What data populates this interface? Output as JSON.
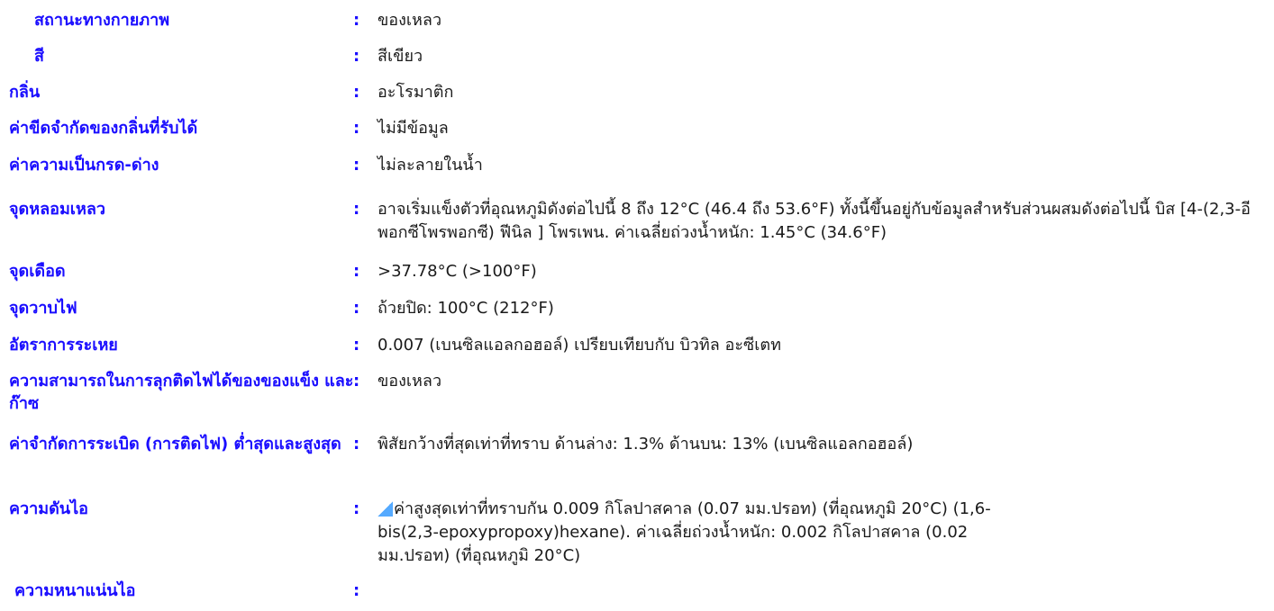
{
  "properties": [
    {
      "label": "สถานะทางกายภาพ",
      "colon": ":",
      "value": "ของเหลว"
    },
    {
      "label": "สี",
      "colon": ":",
      "value": "สีเขียว"
    },
    {
      "label": "กลิ่น",
      "colon": ":",
      "value": "อะโรมาติก"
    },
    {
      "label": "ค่าขีดจำกัดของกลิ่นที่รับได้",
      "colon": ":",
      "value": "ไม่มีข้อมูล"
    },
    {
      "label": "ค่าความเป็นกรด-ด่าง",
      "colon": ":",
      "value": "ไม่ละลายในน้ำ"
    },
    {
      "label": "จุดหลอมเหลว",
      "colon": ":",
      "value": "อาจเริ่มแข็งตัวที่อุณหภูมิดังต่อไปนี้ 8 ถึง 12°C (46.4 ถึง 53.6°F) ทั้งนี้ขึ้นอยู่กับข้อมูลสำหรับส่วนผสมดังต่อไปนี้ บิส [4-(2,3-อีพอกซีโพรพอกซี) ฟีนิล ] โพรเพน. ค่าเฉลี่ยถ่วงน้ำหนัก: 1.45°C (34.6°F)"
    },
    {
      "label": "จุดเดือด",
      "colon": ":",
      "value": ">37.78°C (>100°F)"
    },
    {
      "label": "จุดวาบไฟ",
      "colon": ":",
      "value": "ถ้วยปิด: 100°C (212°F)"
    },
    {
      "label": "อัตราการระเหย",
      "colon": ":",
      "value": "0.007 (เบนซิลแอลกอฮอล์) เปรียบเทียบกับ บิวทิล อะซีเตท"
    },
    {
      "label": "ความสามารถในการลุกติดไฟได้ของของแข็ง และก๊าซ",
      "colon": ":",
      "value": "ของเหลว"
    },
    {
      "label": "ค่าจำกัดการระเบิด (การติดไฟ) ต่ำสุดและสูงสุด",
      "colon": ":",
      "value": "พิสัยกว้างที่สุดเท่าที่ทราบ ด้านล่าง: 1.3%  ด้านบน: 13% (เบนซิลแอลกอฮอล์)"
    },
    {
      "label": "ความดันไอ",
      "colon": ":",
      "value": "ค่าสูงสุดเท่าที่ทราบกัน 0.009 กิโลปาสคาล (0.07 มม.ปรอท) (ที่อุณหภูมิ 20°C) (1,6-bis(2,3-epoxypropoxy)hexane).  ค่าเฉลี่ยถ่วงน้ำหนัก: 0.002 กิโลปาสคาล (0.02 มม.ปรอท) (ที่อุณหภูมิ 20°C)"
    },
    {
      "label": "ความหนาแน่นไอ",
      "colon": ":",
      "value": ""
    }
  ]
}
